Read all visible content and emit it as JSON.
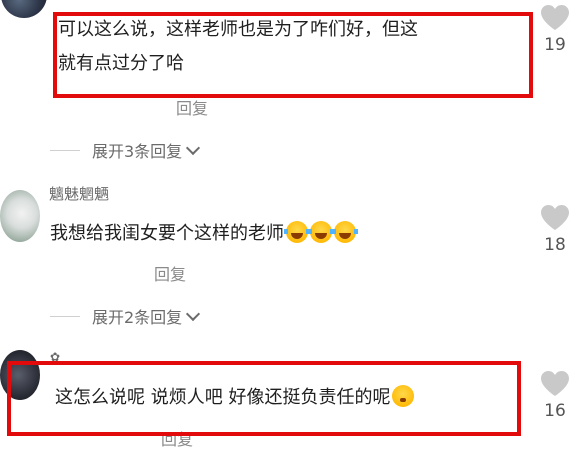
{
  "comments": [
    {
      "text_line1": "可以这么说，这样老师也是为了咋们好，但这",
      "text_line2": "就有点过分了哈",
      "reply_label": "回复",
      "expand_label": "展开3条回复",
      "like_count": "19"
    },
    {
      "username": "魑魅魍魉",
      "text": "我想给我闺女要个这样的老师",
      "emojis": [
        "laugh-cry-icon",
        "laugh-cry-icon",
        "laugh-cry-icon"
      ],
      "reply_label": "回复",
      "expand_label": "展开2条回复",
      "like_count": "18"
    },
    {
      "username": "✿",
      "text": "这怎么说呢 说烦人吧 好像还挺负责任的呢",
      "emojis": [
        "worried-face-icon"
      ],
      "reply_label": "回复",
      "like_count": "16"
    }
  ],
  "colors": {
    "highlight": "#e20a0a",
    "text": "#1f1f1f",
    "muted": "#8a8a8a"
  }
}
